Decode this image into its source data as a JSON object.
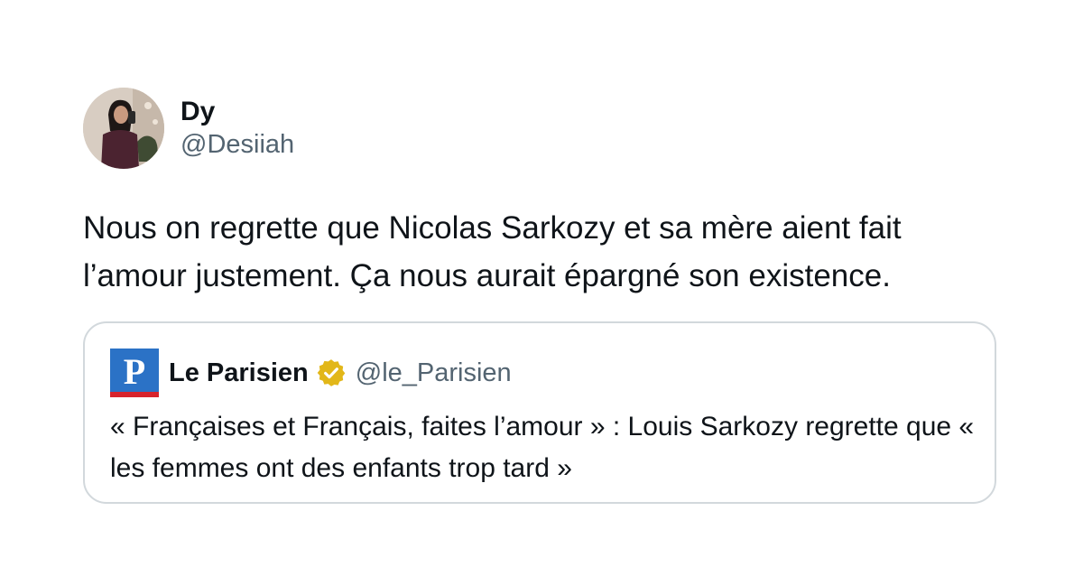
{
  "tweet": {
    "author": {
      "display_name": "Dy",
      "handle": "@Desiiah",
      "avatar_icon": "profile-photo"
    },
    "text": "Nous on regrette que Nicolas Sarkozy et sa mère aient fait l’amour justement. Ça nous aurait épargné son existence.",
    "quoted": {
      "logo_icon": "le-parisien-logo",
      "logo_letter": "P",
      "name": "Le Parisien",
      "verified_icon": "verified-badge-icon",
      "handle": "@le_Parisien",
      "text": "« Françaises et Français, faites l’amour » : Louis Sarkozy regrette que « les femmes ont des enfants trop tard »"
    }
  },
  "colors": {
    "text_primary": "#0f1419",
    "text_secondary": "#536471",
    "card_border": "#d2d8dc",
    "verified_gold": "#e2b719",
    "logo_blue": "#2b72c6",
    "logo_red": "#d7232c"
  }
}
